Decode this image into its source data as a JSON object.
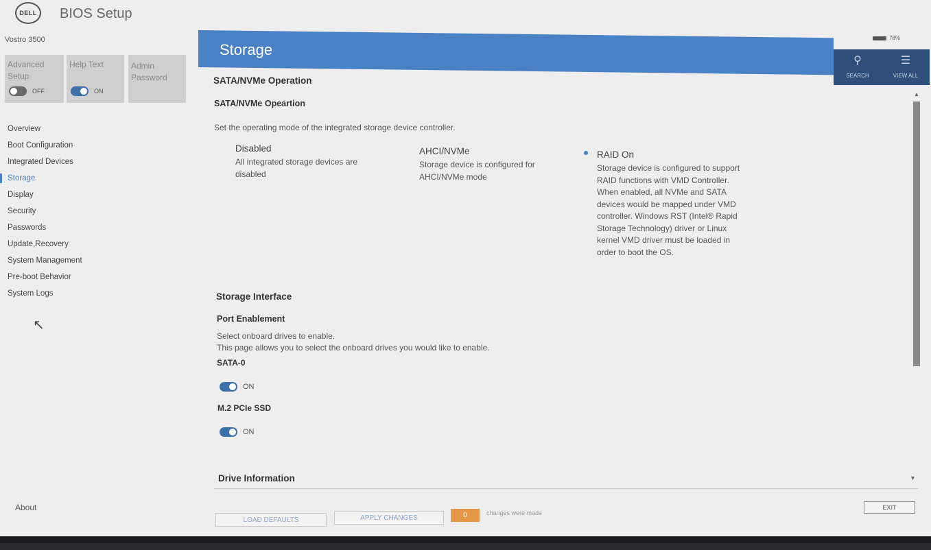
{
  "header": {
    "logo_text": "DELL",
    "app_title": "BIOS Setup",
    "model": "Vostro 3500",
    "battery": "78%"
  },
  "quick_tiles": [
    {
      "label": "Advanced Setup",
      "state": "OFF"
    },
    {
      "label": "Help Text",
      "state": "ON"
    },
    {
      "label": "Admin Password"
    }
  ],
  "sidebar": {
    "items": [
      {
        "label": "Overview"
      },
      {
        "label": "Boot Configuration"
      },
      {
        "label": "Integrated Devices"
      },
      {
        "label": "Storage"
      },
      {
        "label": "Display"
      },
      {
        "label": "Security"
      },
      {
        "label": "Passwords"
      },
      {
        "label": "Update,Recovery"
      },
      {
        "label": "System Management"
      },
      {
        "label": "Pre-boot Behavior"
      },
      {
        "label": "System Logs"
      }
    ],
    "active_index": 3,
    "about": "About"
  },
  "page": {
    "title": "Storage",
    "tools": {
      "search": "SEARCH",
      "view_all": "VIEW ALL"
    },
    "accent_color": "#4a80c4"
  },
  "sata": {
    "section_title": "SATA/NVMe Operation",
    "setting_title": "SATA/NVMe Opeartion",
    "description": "Set the operating mode of the integrated storage device controller.",
    "options": [
      {
        "title": "Disabled",
        "desc": "All integrated storage devices are disabled"
      },
      {
        "title": "AHCI/NVMe",
        "desc": "Storage device is configured for AHCI/NVMe mode"
      },
      {
        "title": "RAID On",
        "desc": "Storage device is configured to support RAID functions with VMD Controller. When enabled, all NVMe and SATA devices would be mapped under VMD controller. Windows RST (Intel® Rapid Storage Technology) driver or Linux kernel VMD driver must be loaded in order to boot the OS."
      }
    ],
    "selected": "RAID On"
  },
  "storage_interface": {
    "section_title": "Storage Interface",
    "setting_title": "Port Enablement",
    "desc1": "Select onboard drives to enable.",
    "desc2": "This page allows you to select the onboard drives you would like to enable.",
    "ports": [
      {
        "label": "SATA-0",
        "state": "ON"
      },
      {
        "label": "M.2 PCIe SSD",
        "state": "ON"
      }
    ]
  },
  "drive_info": {
    "section_title": "Drive Information"
  },
  "footer": {
    "load_defaults": "LOAD DEFAULTS",
    "apply_changes": "APPLY CHANGES",
    "change_count": "0",
    "changes_text": "changes were made",
    "exit": "EXIT"
  }
}
